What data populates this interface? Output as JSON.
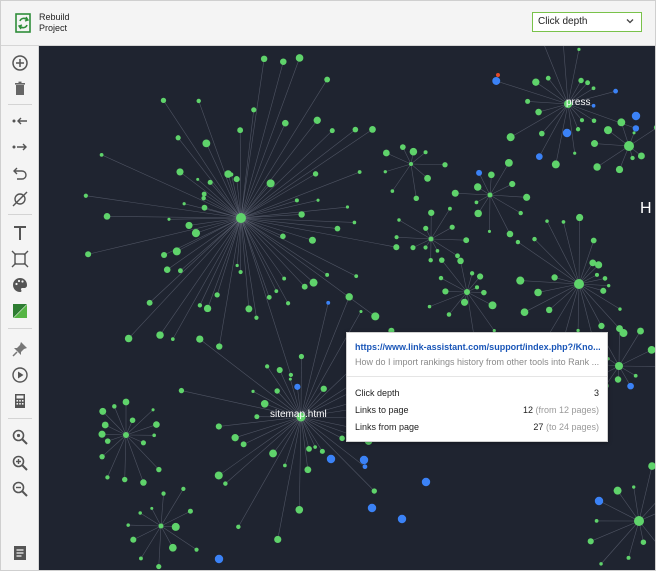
{
  "header": {
    "rebuild_label": "Rebuild\nProject",
    "view_select": "Click depth"
  },
  "toolbar": [
    {
      "name": "add-node-icon",
      "title": "add"
    },
    {
      "name": "delete-icon",
      "title": "delete"
    },
    {
      "name": "collapse-left-icon",
      "title": "collapse"
    },
    {
      "name": "expand-right-icon",
      "title": "expand"
    },
    {
      "name": "undo-icon",
      "title": "undo"
    },
    {
      "name": "hide-node-icon",
      "title": "hide"
    },
    {
      "name": "text-icon",
      "title": "text"
    },
    {
      "name": "fit-frame-icon",
      "title": "fit"
    },
    {
      "name": "palette-icon",
      "title": "palette"
    },
    {
      "name": "color-split-icon",
      "title": "color"
    },
    {
      "name": "pin-icon",
      "title": "pin"
    },
    {
      "name": "play-icon",
      "title": "play"
    },
    {
      "name": "calculator-icon",
      "title": "calculate"
    },
    {
      "name": "zoom-search-icon",
      "title": "zoom"
    },
    {
      "name": "zoom-in-icon",
      "title": "zoom in"
    },
    {
      "name": "zoom-out-icon",
      "title": "zoom out"
    },
    {
      "name": "notes-icon",
      "title": "notes"
    }
  ],
  "graph": {
    "labels": {
      "press": "press",
      "sitemap": "sitemap.html",
      "h": "H"
    },
    "colors": {
      "background": "#1f2430",
      "node_green": "#5fd36b",
      "node_blue": "#3b82f6",
      "node_red": "#e24a2a",
      "edge": "#a9b0c4"
    }
  },
  "tooltip": {
    "url": "https://www.link-assistant.com/support/index.php?/Kno...",
    "description": "How do I import rankings history from other tools into Rank ...",
    "rows": [
      {
        "label": "Click depth",
        "value": "3",
        "sub": ""
      },
      {
        "label": "Links to page",
        "value": "12",
        "sub": "(from 12 pages)"
      },
      {
        "label": "Links from page",
        "value": "27",
        "sub": "(to 24 pages)"
      }
    ]
  }
}
